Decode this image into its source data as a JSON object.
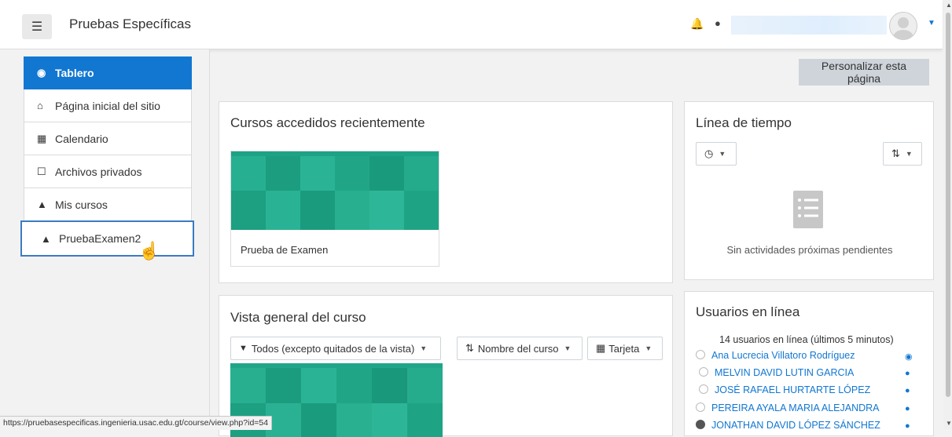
{
  "navbar": {
    "menu_icon": "hamburger-icon",
    "site_name": "Pruebas Específicas",
    "notifications_icon": "bell-icon",
    "messages_icon": "chat-icon"
  },
  "sidebar": {
    "items": [
      {
        "label": "Tablero",
        "icon": "dashboard-icon"
      },
      {
        "label": "Página inicial del sitio",
        "icon": "home-icon"
      },
      {
        "label": "Calendario",
        "icon": "calendar-icon"
      },
      {
        "label": "Archivos privados",
        "icon": "file-icon"
      },
      {
        "label": "Mis cursos",
        "icon": "graduation-cap-icon"
      },
      {
        "label": "PruebaExamen2",
        "icon": "graduation-cap-icon"
      }
    ]
  },
  "main": {
    "customize_button": "Personalizar esta página",
    "recent_courses": {
      "title": "Cursos accedidos recientemente",
      "course_name": "Prueba de Examen"
    },
    "course_overview": {
      "title": "Vista general del curso",
      "filter_label": "Todos (excepto quitados de la vista)",
      "sort_label": "Nombre del curso",
      "view_label": "Tarjeta"
    }
  },
  "timeline": {
    "title": "Línea de tiempo",
    "empty_text": "Sin actividades próximas pendientes"
  },
  "online_users": {
    "title": "Usuarios en línea",
    "summary": "14 usuarios en línea (últimos 5 minutos)",
    "users": [
      "Ana Lucrecia Villatoro Rodríguez",
      "MELVIN DAVID LUTIN GARCIA",
      "JOSÉ RAFAEL HURTARTE LÓPEZ",
      "PEREIRA AYALA MARIA ALEJANDRA",
      "JONATHAN DAVID LÓPEZ SÁNCHEZ"
    ]
  },
  "status_bar": {
    "url": "https://pruebasespecificas.ingenieria.usac.edu.gt/course/view.php?id=54"
  },
  "colors": {
    "primary": "#1177d1",
    "course_pattern": "#1fa688"
  }
}
